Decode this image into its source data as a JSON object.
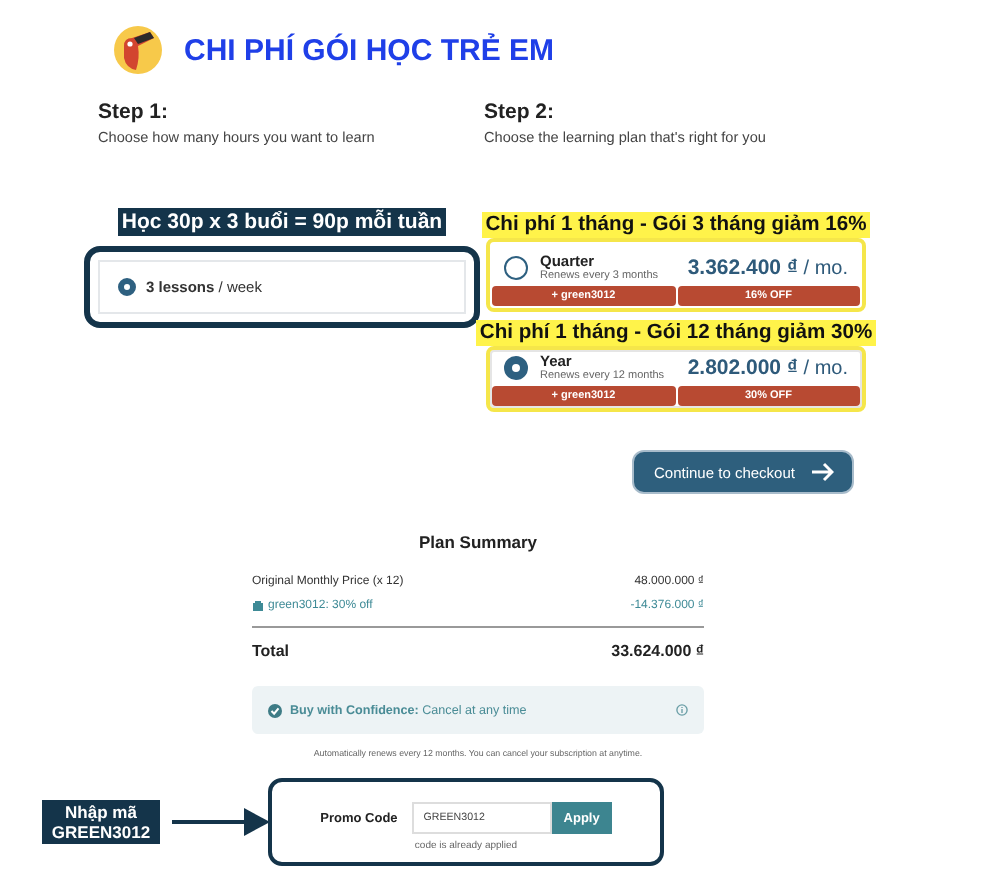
{
  "header": {
    "title": "CHI PHÍ GÓI HỌC TRẺ EM"
  },
  "steps": [
    {
      "title": "Step 1:",
      "description": "Choose how many hours you want to learn"
    },
    {
      "title": "Step 2:",
      "description": "Choose the learning plan that's right for you"
    }
  ],
  "lessons": {
    "annotation": "Học 30p x 3 buổi = 90p mỗi tuần",
    "options": [
      {
        "count": "3 lessons",
        "unit": "/ week",
        "selected": true
      }
    ]
  },
  "plans": [
    {
      "annotation": "Chi phí 1 tháng - Gói 3 tháng giảm 16%",
      "name": "Quarter",
      "renews": "Renews every 3 months",
      "price": "3.362.400 ₫",
      "unit": "/ mo.",
      "promo": "+ green3012",
      "discount": "16% OFF",
      "selected": false
    },
    {
      "annotation": "Chi phí 1 tháng - Gói 12 tháng giảm 30%",
      "name": "Year",
      "renews": "Renews every 12 months",
      "price": "2.802.000 ₫",
      "unit": "/ mo.",
      "promo": "+ green3012",
      "discount": "30% OFF",
      "selected": true
    }
  ],
  "checkout_button": "Continue to checkout",
  "summary": {
    "title": "Plan Summary",
    "rows": [
      {
        "kind": "price",
        "label": "Original Monthly Price (x 12)",
        "value": "48.000.000 ₫"
      },
      {
        "kind": "discount",
        "label": "green3012: 30% off",
        "value": "-14.376.000 ₫"
      }
    ],
    "total_label": "Total",
    "total_value": "33.624.000 ₫"
  },
  "confidence": {
    "title": "Buy with Confidence:",
    "text": "Cancel at any time"
  },
  "renew_note": "Automatically renews every 12 months. You can cancel your subscription at anytime.",
  "promo": {
    "annotation": "Nhập mã GREEN3012",
    "label": "Promo Code",
    "value": "GREEN3012",
    "button": "Apply",
    "note": "code is already applied"
  }
}
